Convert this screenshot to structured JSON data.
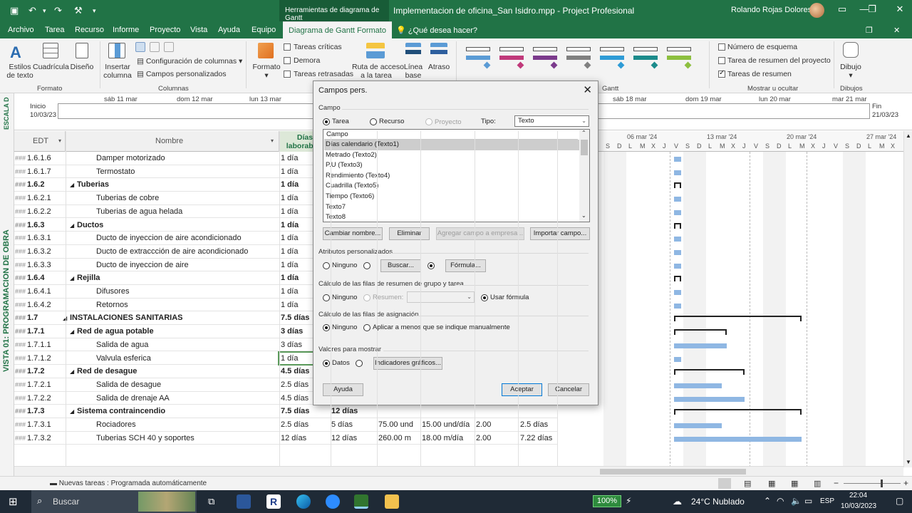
{
  "titlebar": {
    "context_tools": "Herramientas de diagrama de Gantt",
    "document_title": "Implementacion de oficina_San Isidro.mpp  -  Project Profesional",
    "user": "Rolando Rojas Dolores"
  },
  "menu": [
    "Archivo",
    "Tarea",
    "Recurso",
    "Informe",
    "Proyecto",
    "Vista",
    "Ayuda",
    "Equipo"
  ],
  "active_tab": "Diagrama de Gantt  Formato",
  "tell_me": "¿Qué desea hacer?",
  "ribbon": {
    "estilos_texto": "Estilos\nde texto",
    "cuadricula": "Cuadrícula",
    "diseno": "Diseño",
    "insertar_columna": "Insertar\ncolumna",
    "config_columnas": "Configuración de columnas",
    "campos_personalizados": "Campos personalizados",
    "formato": "Formato",
    "tareas_criticas": "Tareas críticas",
    "demora": "Demora",
    "tareas_retrasadas": "Tareas retrasadas",
    "ruta_acceso": "Ruta de acceso\na la tarea",
    "linea_base": "Línea\nbase",
    "atraso": "Atraso",
    "numero_esquema": "Número de esquema",
    "tarea_resumen_proyecto": "Tarea de resumen del proyecto",
    "tareas_resumen": "Tareas de resumen",
    "dibujo": "Dibujo",
    "groups": {
      "formato": "Formato",
      "columnas": "Columnas",
      "gantt": "Gantt",
      "mostrar_ocultar": "Mostrar u ocultar",
      "dibujos": "Dibujos"
    },
    "gantt_style_colors": [
      "#5b9bd5",
      "#c0397a",
      "#7b3a8c",
      "#808080",
      "#2e9bd6",
      "#1b8b8b",
      "#8dbf3f"
    ]
  },
  "timeline": {
    "side_label": "ESCALA D",
    "inicio_label": "Inicio",
    "inicio_date": "10/03/23",
    "fin_label": "Fin",
    "fin_date": "21/03/23",
    "dates": [
      "sáb 11 mar",
      "dom 12 mar",
      "lun 13 mar",
      "sáb 18 mar",
      "dom 19 mar",
      "lun 20 mar",
      "mar 21 mar"
    ]
  },
  "view_label": "VISTA 01: PROGRAMACION DE OBRA",
  "table": {
    "headers": {
      "edt": "EDT",
      "nombre": "Nombre",
      "dias": "Días laborables"
    },
    "rows": [
      {
        "edt": "1.6.1.6",
        "name": "Damper motorizado",
        "dias": "1 día",
        "level": 3,
        "bold": false,
        "extra": []
      },
      {
        "edt": "1.6.1.7",
        "name": "Termostato",
        "dias": "1 día",
        "level": 3,
        "bold": false,
        "extra": []
      },
      {
        "edt": "1.6.2",
        "name": "Tuberias",
        "dias": "1 día",
        "level": 2,
        "bold": true,
        "extra": []
      },
      {
        "edt": "1.6.2.1",
        "name": "Tuberias de cobre",
        "dias": "1 día",
        "level": 3,
        "bold": false,
        "extra": []
      },
      {
        "edt": "1.6.2.2",
        "name": "Tuberias de agua helada",
        "dias": "1 día",
        "level": 3,
        "bold": false,
        "extra": []
      },
      {
        "edt": "1.6.3",
        "name": "Ductos",
        "dias": "1 día",
        "level": 2,
        "bold": true,
        "extra": []
      },
      {
        "edt": "1.6.3.1",
        "name": "Ducto de inyeccion de aire acondicionado",
        "dias": "1 día",
        "level": 3,
        "bold": false,
        "extra": []
      },
      {
        "edt": "1.6.3.2",
        "name": "Ducto de extraccción de aire acondicionado",
        "dias": "1 día",
        "level": 3,
        "bold": false,
        "extra": []
      },
      {
        "edt": "1.6.3.3",
        "name": "Ducto de inyeccion de aire",
        "dias": "1 día",
        "level": 3,
        "bold": false,
        "extra": []
      },
      {
        "edt": "1.6.4",
        "name": "Rejilla",
        "dias": "1 día",
        "level": 2,
        "bold": true,
        "extra": []
      },
      {
        "edt": "1.6.4.1",
        "name": "Difusores",
        "dias": "1 día",
        "level": 3,
        "bold": false,
        "extra": []
      },
      {
        "edt": "1.6.4.2",
        "name": "Retornos",
        "dias": "1 día",
        "level": 3,
        "bold": false,
        "extra": []
      },
      {
        "edt": "1.7",
        "name": "INSTALACIONES SANITARIAS",
        "dias": "7.5 días",
        "level": 1,
        "bold": true,
        "extra": []
      },
      {
        "edt": "1.7.1",
        "name": "Red de agua potable",
        "dias": "3 días",
        "level": 2,
        "bold": true,
        "extra": []
      },
      {
        "edt": "1.7.1.1",
        "name": "Salida de agua",
        "dias": "3 días",
        "level": 3,
        "bold": false,
        "extra": []
      },
      {
        "edt": "1.7.1.2",
        "name": "Valvula esferica",
        "dias": "1 día",
        "level": 3,
        "bold": false,
        "extra": []
      },
      {
        "edt": "1.7.2",
        "name": "Red de desague",
        "dias": "4.5 días",
        "level": 2,
        "bold": true,
        "extra": []
      },
      {
        "edt": "1.7.2.1",
        "name": "Salida de desague",
        "dias": "2.5 días",
        "level": 3,
        "bold": false,
        "extra": []
      },
      {
        "edt": "1.7.2.2",
        "name": "Salida de drenaje AA",
        "dias": "4.5 días",
        "level": 3,
        "bold": false,
        "extra": []
      },
      {
        "edt": "1.7.3",
        "name": "Sistema contraincendio",
        "dias": "7.5 días",
        "level": 2,
        "bold": true,
        "extra": [
          "12 días"
        ]
      },
      {
        "edt": "1.7.3.1",
        "name": "Rociadores",
        "dias": "2.5 días",
        "level": 3,
        "bold": false,
        "extra": [
          "5 días",
          "75.00 und",
          "15.00 und/día",
          "2.00",
          "2.5 días"
        ]
      },
      {
        "edt": "1.7.3.2",
        "name": "Tuberias SCH 40 y soportes",
        "dias": "12 días",
        "level": 3,
        "bold": false,
        "extra": [
          "12 días",
          "260.00 m",
          "18.00 m/día",
          "2.00",
          "7.22 días"
        ]
      }
    ]
  },
  "gantt": {
    "weeks": [
      "06 mar '24",
      "13 mar '24",
      "20 mar '24",
      "27 mar '24"
    ],
    "days": [
      "S",
      "D",
      "L",
      "M",
      "X",
      "J",
      "V",
      "S",
      "D",
      "L",
      "M",
      "X",
      "J",
      "V",
      "S",
      "D",
      "L",
      "M",
      "X",
      "J",
      "V",
      "S",
      "D",
      "L",
      "M",
      "X"
    ]
  },
  "dialog": {
    "title": "Campos pers.",
    "campo_section": "Campo",
    "tarea": "Tarea",
    "recurso": "Recurso",
    "proyecto": "Proyecto",
    "tipo_label": "Tipo:",
    "tipo_value": "Texto",
    "list_header": "Campo",
    "list_items": [
      "Días calendario (Texto1)",
      "Metrado (Texto2)",
      "P.U (Texto3)",
      "Rendimiento (Texto4)",
      "Cuadrilla (Texto5)",
      "Tiempo (Texto6)",
      "Texto7",
      "Texto8"
    ],
    "cambiar_nombre": "Cambiar nombre...",
    "eliminar": "Eliminar",
    "agregar_campo": "Agregar campo a empresa...",
    "importar_campo": "Importar campo...",
    "atributos_section": "Atributos personalizados",
    "ninguno": "Ninguno",
    "buscar": "Buscar...",
    "formula": "Fórmula...",
    "calculo_resumen_section": "Cálculo de las filas de resumen de grupo y tarea",
    "resumen": "Resumen:",
    "usar_formula": "Usar fórmula",
    "calculo_asignacion_section": "Cálculo de las filas de asignación",
    "aplicar_menos": "Aplicar a menos que se indique manualmente",
    "valores_section": "Valores para mostrar",
    "datos": "Datos",
    "indicadores": "Indicadores gráficos...",
    "ayuda": "Ayuda",
    "aceptar": "Aceptar",
    "cancelar": "Cancelar"
  },
  "statusbar": {
    "nuevas_tareas": "Nuevas tareas : Programada automáticamente"
  },
  "taskbar": {
    "search": "Buscar",
    "battery": "100%",
    "weather": "24°C  Nublado",
    "lang": "ESP",
    "time": "22:04",
    "date": "10/03/2023"
  }
}
